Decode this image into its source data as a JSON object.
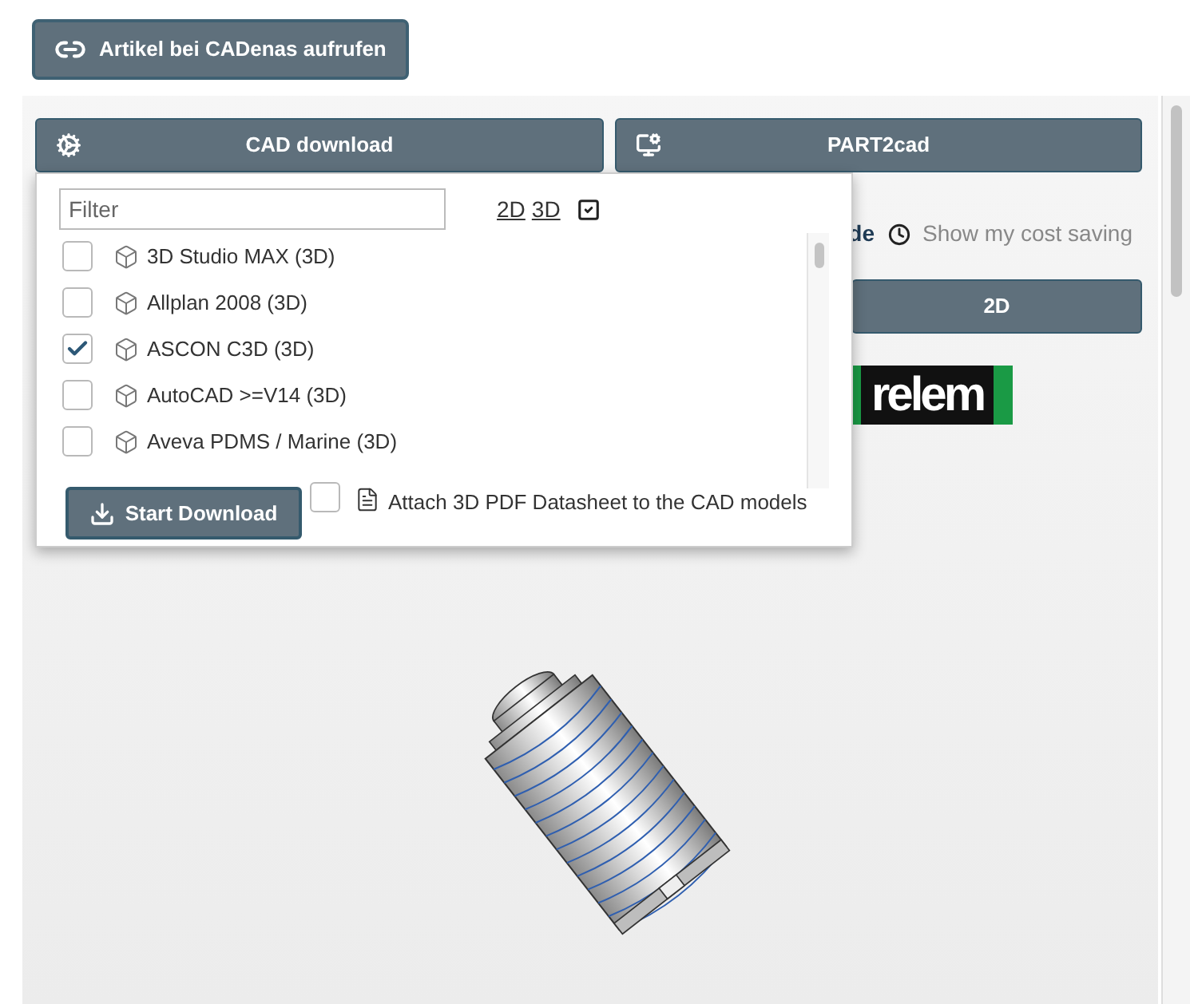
{
  "link_button": {
    "label": "Artikel bei CADenas aufrufen"
  },
  "action_buttons": [
    {
      "label": "CAD download",
      "kind": "download"
    },
    {
      "label": "PART2cad",
      "kind": "part2cad"
    }
  ],
  "behind_dropdown": {
    "partial_text": "de",
    "cost_saving": "Show my cost saving",
    "view_tab": "2D",
    "logo_text": "relem"
  },
  "dropdown": {
    "filter": {
      "placeholder": "Filter"
    },
    "type_links": [
      "2D",
      "3D"
    ],
    "formats": [
      {
        "label": "3D Studio MAX (3D)",
        "checked": false
      },
      {
        "label": "Allplan 2008 (3D)",
        "checked": false
      },
      {
        "label": "ASCON C3D (3D)",
        "checked": true
      },
      {
        "label": "AutoCAD >=V14 (3D)",
        "checked": false
      },
      {
        "label": "Aveva PDMS / Marine (3D)",
        "checked": false
      }
    ],
    "start_button": "Start Download",
    "attach_pdf": {
      "label": "Attach 3D PDF Datasheet to the CAD models",
      "checked": false
    }
  }
}
